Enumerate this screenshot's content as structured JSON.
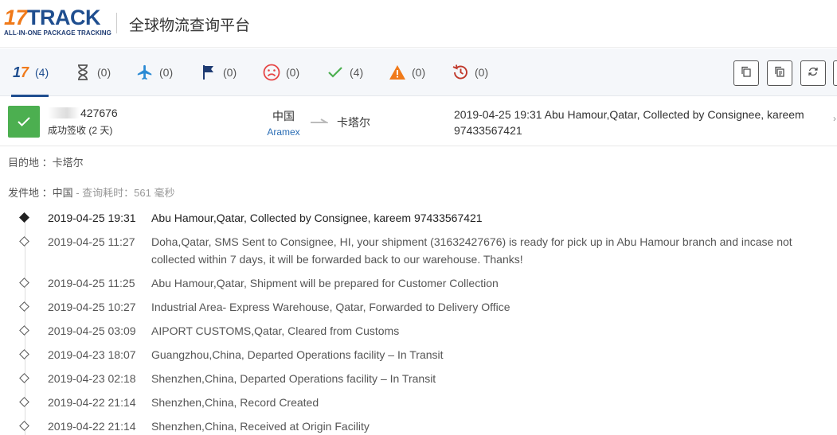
{
  "header": {
    "logo_number": "17",
    "logo_word": "TRACK",
    "logo_tagline": "ALL-IN-ONE PACKAGE TRACKING",
    "site_title": "全球物流查询平台"
  },
  "tabs": [
    {
      "name": "all",
      "count": "(4)",
      "icon": "17track-logo",
      "color": "#1f4e8f"
    },
    {
      "name": "not-found",
      "count": "(0)",
      "icon": "hourglass-icon",
      "color": "#555555"
    },
    {
      "name": "in-transit",
      "count": "(0)",
      "icon": "plane-icon",
      "color": "#2a8ad4"
    },
    {
      "name": "pick-up",
      "count": "(0)",
      "icon": "flag-icon",
      "color": "#1f3c73"
    },
    {
      "name": "undelivered",
      "count": "(0)",
      "icon": "sad-face-icon",
      "color": "#e64545"
    },
    {
      "name": "delivered",
      "count": "(4)",
      "icon": "check-icon",
      "color": "#4caf50"
    },
    {
      "name": "alert",
      "count": "(0)",
      "icon": "warning-icon",
      "color": "#f07a1a"
    },
    {
      "name": "expired",
      "count": "(0)",
      "icon": "history-icon",
      "color": "#c0392b"
    }
  ],
  "summary": {
    "tracking_suffix": "427676",
    "status": "成功签收 (2 天)",
    "origin_country": "中国",
    "carrier": "Aramex",
    "destination_country": "卡塔尔",
    "latest_event": "2019-04-25 19:31  Abu Hamour,Qatar, Collected by Consignee, kareem 97433567421",
    "status_color": "#4caf50"
  },
  "details": {
    "destination_label": "目的地 ：卡塔尔",
    "origin_label": "发件地 ：中国",
    "query_time": " - 查询耗时：561 毫秒"
  },
  "events": [
    {
      "time": "2019-04-25 19:31",
      "desc": "Abu Hamour,Qatar, Collected by Consignee, kareem 97433567421"
    },
    {
      "time": "2019-04-25 11:27",
      "desc": "Doha,Qatar, SMS Sent to Consignee, HI, your shipment (31632427676) is ready for pick up in Abu Hamour branch and incase not collected within 7 days, it will be forwarded back to our warehouse. Thanks!"
    },
    {
      "time": "2019-04-25 11:25",
      "desc": "Abu Hamour,Qatar, Shipment will be prepared for Customer Collection"
    },
    {
      "time": "2019-04-25 10:27",
      "desc": "Industrial Area- Express Warehouse, Qatar, Forwarded to Delivery Office"
    },
    {
      "time": "2019-04-25 03:09",
      "desc": "AIPORT CUSTOMS,Qatar, Cleared from Customs"
    },
    {
      "time": "2019-04-23 18:07",
      "desc": "Guangzhou,China, Departed Operations facility – In Transit"
    },
    {
      "time": "2019-04-23 02:18",
      "desc": "Shenzhen,China, Departed Operations facility – In Transit"
    },
    {
      "time": "2019-04-22 21:14",
      "desc": "Shenzhen,China, Record Created"
    },
    {
      "time": "2019-04-22 21:14",
      "desc": "Shenzhen,China, Received at Origin Facility"
    }
  ]
}
